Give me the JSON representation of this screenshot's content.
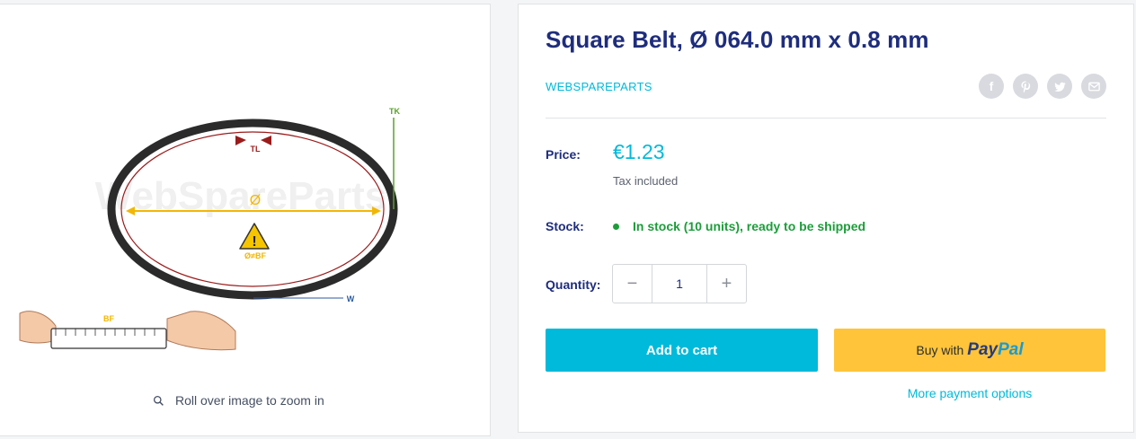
{
  "product": {
    "title": "Square Belt, Ø 064.0 mm x 0.8 mm",
    "vendor": "WEBSPAREPARTS",
    "price_label": "Price:",
    "price": "€1.23",
    "tax_note": "Tax included",
    "stock_label": "Stock:",
    "stock_text": "In stock (10 units), ready to be shipped",
    "quantity_label": "Quantity:",
    "quantity": "1"
  },
  "media": {
    "zoom_hint": "Roll over image to zoom in",
    "image_labels": {
      "tk": "TK",
      "tl": "TL",
      "diameter": "Ø",
      "warning": "Ø≠BF",
      "width": "W",
      "bf": "BF",
      "watermark": "WebSpareParts"
    }
  },
  "actions": {
    "add_to_cart": "Add to cart",
    "buy_with": "Buy with",
    "paypal_1": "Pay",
    "paypal_2": "Pal",
    "more_payment": "More payment options"
  },
  "share": [
    "facebook-icon",
    "pinterest-icon",
    "twitter-icon",
    "email-icon"
  ],
  "colors": {
    "accent": "#00badb",
    "heading": "#1e2d7d",
    "stock": "#1c9d3a",
    "paypal_button": "#ffc439",
    "belt": "#2b2b2b",
    "inner_line": "#9b1b1b",
    "diameter_arrow": "#f2b705",
    "tk_line": "#5aa02c"
  }
}
